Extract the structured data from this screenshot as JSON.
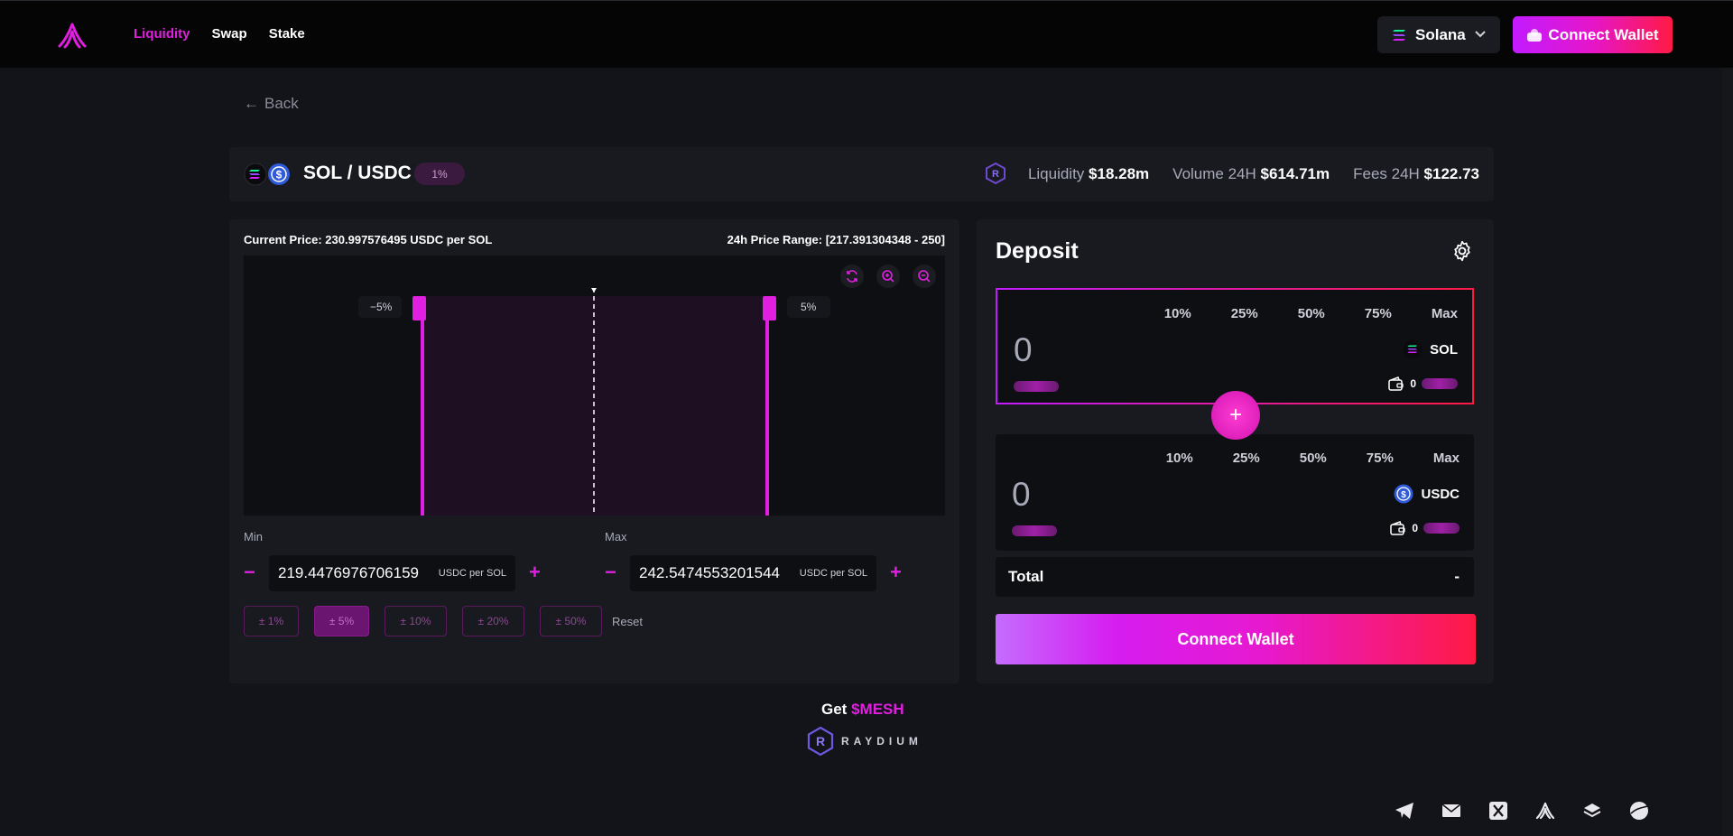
{
  "nav": {
    "items": [
      "Liquidity",
      "Swap",
      "Stake"
    ],
    "active_color": "#e01fe0"
  },
  "header": {
    "chain_label": "Solana",
    "connect_wallet_label": "Connect Wallet"
  },
  "back_label": "Back",
  "pool": {
    "pair_name": "SOL / USDC",
    "fee_badge": "1%",
    "liquidity_label": "Liquidity",
    "liquidity_value": "$18.28m",
    "volume_label": "Volume 24H",
    "volume_value": "$614.71m",
    "fees_label": "Fees 24H",
    "fees_value": "$122.73"
  },
  "range": {
    "current_price_text": "Current Price: 230.997576495 USDC per SOL",
    "price_range_text": "24h Price Range: [217.391304348 - 250]",
    "left_handle_label": "−5%",
    "right_handle_label": "5%",
    "min_label": "Min",
    "max_label": "Max",
    "min_value": "219.4476976706159",
    "max_value": "242.5474553201544",
    "unit": "USDC per SOL",
    "minus": "−",
    "plus": "+",
    "percent_buttons": [
      "± 1%",
      "± 5%",
      "± 10%",
      "± 20%",
      "± 50%"
    ],
    "selected_percent": "± 5%",
    "reset_label": "Reset"
  },
  "deposit": {
    "title": "Deposit",
    "percent_options": [
      "10%",
      "25%",
      "50%",
      "75%",
      "Max"
    ],
    "token_a": {
      "symbol": "SOL",
      "amount": "0",
      "balance": "0"
    },
    "token_b": {
      "symbol": "USDC",
      "amount": "0",
      "balance": "0"
    },
    "plus_symbol": "+",
    "total_label": "Total",
    "total_value": "-",
    "connect_label": "Connect Wallet"
  },
  "footer": {
    "get_label": "Get",
    "mesh_label": "$MESH",
    "raydium_text": "RAYDIUM"
  },
  "icons": {
    "socials": [
      "telegram-icon",
      "mail-icon",
      "x-icon",
      "app-logo-icon",
      "layers-icon",
      "globe-icon"
    ]
  }
}
